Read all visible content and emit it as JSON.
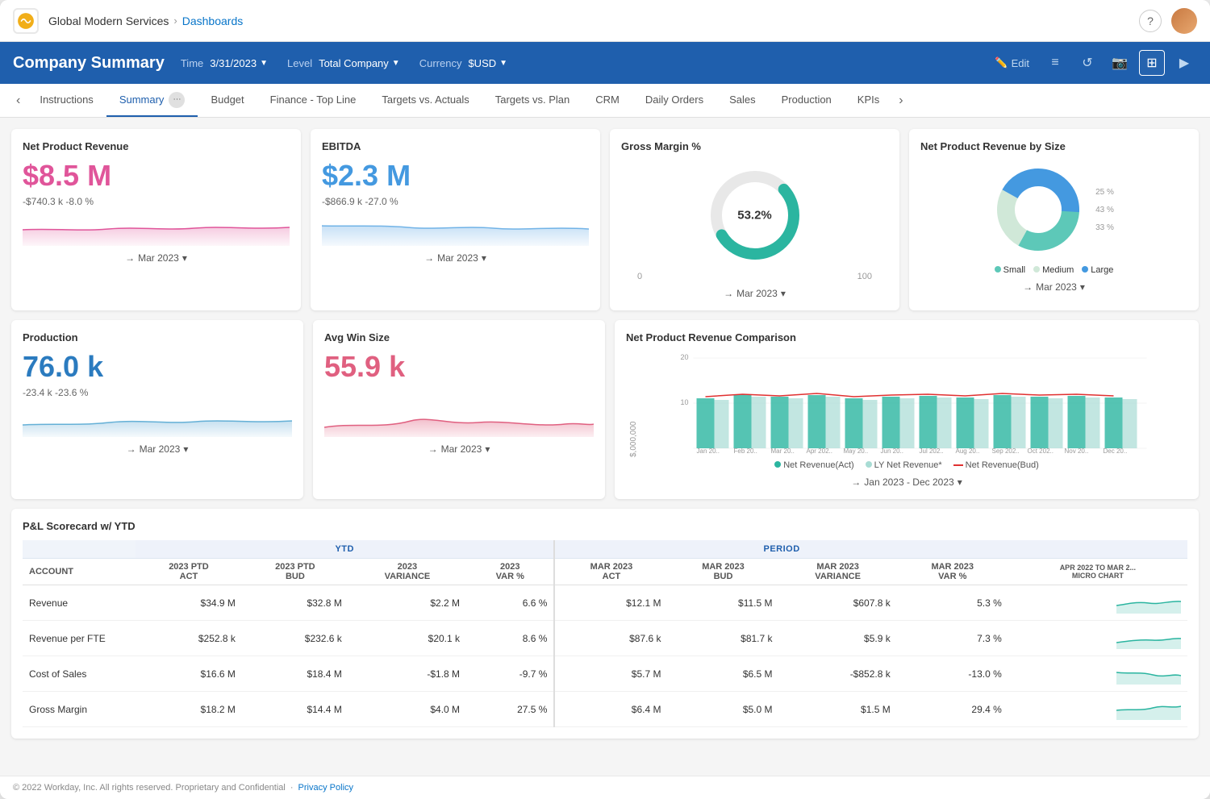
{
  "topNav": {
    "company": "Global Modern Services",
    "dashboards": "Dashboards",
    "help": "?",
    "helpLabel": "help-circle"
  },
  "header": {
    "title": "Company Summary",
    "timeLabel": "Time",
    "timeValue": "3/31/2023",
    "levelLabel": "Level",
    "levelValue": "Total Company",
    "currencyLabel": "Currency",
    "currencyValue": "$USD",
    "editLabel": "Edit"
  },
  "tabs": {
    "prev": "‹",
    "next": "›",
    "items": [
      {
        "label": "Instructions",
        "active": false
      },
      {
        "label": "Summary",
        "active": true
      },
      {
        "label": "Budget",
        "active": false
      },
      {
        "label": "Finance - Top Line",
        "active": false
      },
      {
        "label": "Targets vs. Actuals",
        "active": false
      },
      {
        "label": "Targets vs. Plan",
        "active": false
      },
      {
        "label": "CRM",
        "active": false
      },
      {
        "label": "Daily Orders",
        "active": false
      },
      {
        "label": "Sales",
        "active": false
      },
      {
        "label": "Production",
        "active": false
      },
      {
        "label": "KPIs",
        "active": false
      }
    ]
  },
  "cards": {
    "netProductRevenue": {
      "title": "Net Product Revenue",
      "value": "$8.5 M",
      "delta": "-$740.3 k  -8.0 %",
      "footer": "Mar 2023"
    },
    "ebitda": {
      "title": "EBITDA",
      "value": "$2.3 M",
      "delta": "-$866.9 k  -27.0 %",
      "footer": "Mar 2023"
    },
    "grossMargin": {
      "title": "Gross Margin %",
      "centerValue": "53.2%",
      "scaleMin": "0",
      "scaleMax": "100",
      "footer": "Mar 2023"
    },
    "netProductRevenueBySize": {
      "title": "Net Product Revenue by Size",
      "pct25": "25 %",
      "pct43": "43 %",
      "pct33": "33 %",
      "legendSmall": "Small",
      "legendMedium": "Medium",
      "legendLarge": "Large",
      "footer": "Mar 2023"
    },
    "production": {
      "title": "Production",
      "value": "76.0 k",
      "delta": "-23.4 k  -23.6 %",
      "footer": "Mar 2023"
    },
    "avgWinSize": {
      "title": "Avg Win Size",
      "value": "55.9 k",
      "delta": "",
      "footer": "Mar 2023"
    },
    "netProductRevenueComparison": {
      "title": "Net Product Revenue Comparison",
      "yAxisLabel": "$,000,000",
      "yMax": "20",
      "yMid": "10",
      "legend": {
        "netActual": "Net Revenue(Act)",
        "lyNet": "LY Net Revenue*",
        "netBud": "Net Revenue(Bud)"
      },
      "xLabels": [
        "Jan 20..",
        "Feb 20..",
        "Mar 20..",
        "Apr 202..",
        "May 20..",
        "Jun 20..",
        "Jul 202..",
        "Aug 20..",
        "Sep 202..",
        "Oct 202..",
        "Nov 20..",
        "Dec 20.."
      ],
      "footer": "Jan 2023 - Dec 2023"
    }
  },
  "scorecard": {
    "title": "P&L Scorecard w/ YTD",
    "groups": {
      "ytd": "YTD",
      "period": "PERIOD"
    },
    "columns": {
      "account": "ACCOUNT",
      "ytd2023Act": "2023 PTD ACT",
      "ytd2023Bud": "2023 PTD BUD",
      "ytd2023Var": "2023 VARIANCE",
      "ytd2023VarPct": "2023 VAR %",
      "mar2023Act": "MAR 2023 ACT",
      "mar2023Bud": "MAR 2023 BUD",
      "mar2023Var": "MAR 2023 VARIANCE",
      "mar2023VarPct": "MAR 2023 VAR %",
      "aprToMar": "APR 2022 TO MAR 2... MICRO CHART"
    },
    "rows": [
      {
        "account": "Revenue",
        "ytdAct": "$34.9 M",
        "ytdBud": "$32.8 M",
        "ytdVar": "$2.2 M",
        "ytdVarPct": "6.6 %",
        "perAct": "$12.1 M",
        "perBud": "$11.5 M",
        "perVar": "$607.8 k",
        "perVarPct": "5.3 %"
      },
      {
        "account": "Revenue per FTE",
        "ytdAct": "$252.8 k",
        "ytdBud": "$232.6 k",
        "ytdVar": "$20.1 k",
        "ytdVarPct": "8.6 %",
        "perAct": "$87.6 k",
        "perBud": "$81.7 k",
        "perVar": "$5.9 k",
        "perVarPct": "7.3 %"
      },
      {
        "account": "Cost of Sales",
        "ytdAct": "$16.6 M",
        "ytdBud": "$18.4 M",
        "ytdVar": "-$1.8 M",
        "ytdVarPct": "-9.7 %",
        "perAct": "$5.7 M",
        "perBud": "$6.5 M",
        "perVar": "-$852.8 k",
        "perVarPct": "-13.0 %"
      },
      {
        "account": "Gross Margin",
        "ytdAct": "$18.2 M",
        "ytdBud": "$14.4 M",
        "ytdVar": "$4.0 M",
        "ytdVarPct": "27.5 %",
        "perAct": "$6.4 M",
        "perBud": "$5.0 M",
        "perVar": "$1.5 M",
        "perVarPct": "29.4 %"
      }
    ]
  },
  "footer": {
    "legal": "© 2022 Workday, Inc. All rights reserved. Proprietary and Confidential",
    "privacyPolicy": "Privacy Policy"
  }
}
